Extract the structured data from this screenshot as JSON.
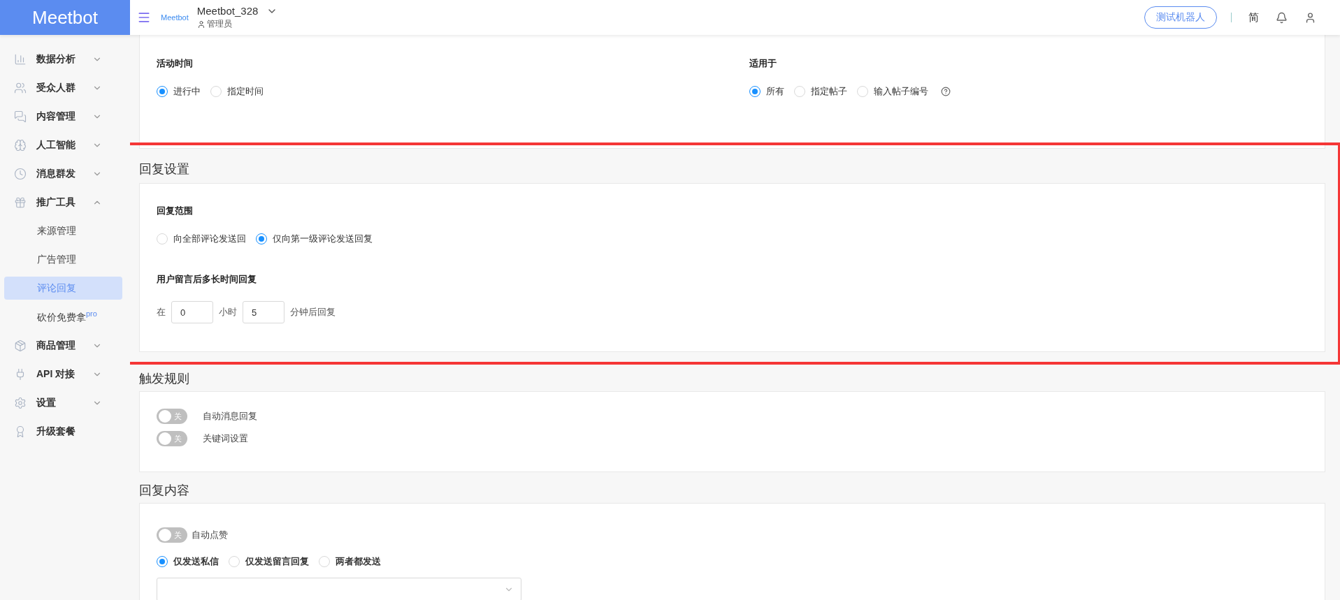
{
  "header": {
    "logo": "Meetbot",
    "small_logo": "Meetbot",
    "account": "Meetbot_328",
    "role": "管理员",
    "test_button": "测试机器人",
    "language": "简"
  },
  "sidebar": {
    "items": [
      {
        "label": "数据分析",
        "kind": "group",
        "expanded": false
      },
      {
        "label": "受众人群",
        "kind": "group",
        "expanded": false
      },
      {
        "label": "内容管理",
        "kind": "group",
        "expanded": false
      },
      {
        "label": "人工智能",
        "kind": "group",
        "expanded": false
      },
      {
        "label": "消息群发",
        "kind": "group",
        "expanded": false
      },
      {
        "label": "推广工具",
        "kind": "group",
        "expanded": true,
        "children": [
          {
            "label": "来源管理",
            "selected": false
          },
          {
            "label": "广告管理",
            "selected": false
          },
          {
            "label": "评论回复",
            "selected": true
          },
          {
            "label": "砍价免费拿",
            "badge": "pro",
            "selected": false
          }
        ]
      },
      {
        "label": "商品管理",
        "kind": "group",
        "expanded": false
      },
      {
        "label": "API 对接",
        "kind": "group",
        "expanded": false
      },
      {
        "label": "设置",
        "kind": "group",
        "expanded": false
      },
      {
        "label": "升级套餐",
        "kind": "link"
      }
    ]
  },
  "activity": {
    "columns": [
      {
        "title": "活动时间",
        "help": false,
        "options": [
          {
            "label": "进行中",
            "selected": true
          },
          {
            "label": "指定时间",
            "selected": false
          }
        ]
      },
      {
        "title": "适用于",
        "help": true,
        "options": [
          {
            "label": "所有",
            "selected": true
          },
          {
            "label": "指定帖子",
            "selected": false
          },
          {
            "label": "输入帖子编号",
            "selected": false
          }
        ]
      }
    ]
  },
  "reply_settings": {
    "title": "回复设置",
    "scope": {
      "label": "回复范围",
      "options": [
        {
          "label": "向全部评论发送回",
          "selected": false
        },
        {
          "label": "仅向第一级评论发送回复",
          "selected": true
        }
      ]
    },
    "delay": {
      "label": "用户留言后多长时间回复",
      "prefix": "在",
      "hours": "0",
      "hours_unit": "小时",
      "minutes": "5",
      "suffix": "分钟后回复"
    }
  },
  "trigger_rules": {
    "title": "触发规则",
    "toggles": [
      {
        "label": "自动消息回复",
        "on": false,
        "state_text": "关"
      },
      {
        "label": "关键词设置",
        "on": false,
        "state_text": "关"
      }
    ]
  },
  "reply_content": {
    "title": "回复内容",
    "like_toggle": {
      "label": "自动点赞",
      "on": false,
      "state_text": "关"
    },
    "send_options": [
      {
        "label": "仅发送私信",
        "selected": true
      },
      {
        "label": "仅发送留言回复",
        "selected": false
      },
      {
        "label": "两者都发送",
        "selected": false
      }
    ]
  }
}
